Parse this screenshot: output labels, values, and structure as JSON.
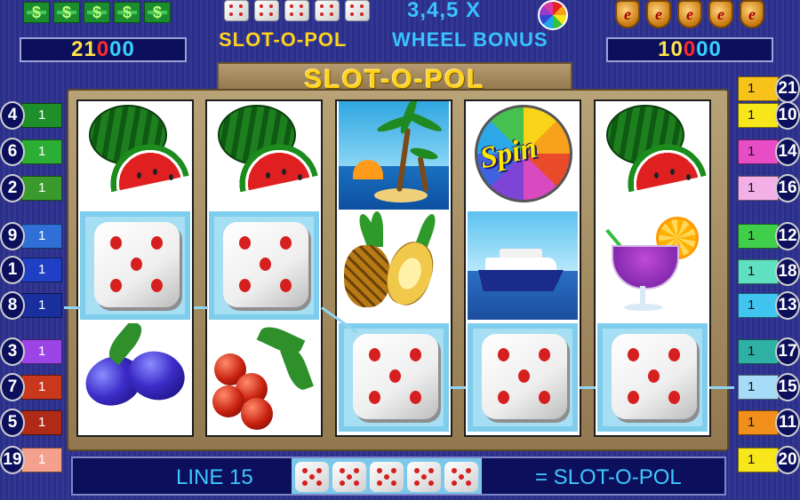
{
  "header": {
    "left_counter": {
      "k": "21",
      "z": "0",
      "r": "00"
    },
    "right_counter": {
      "k": "10",
      "z": "0",
      "r": "00"
    },
    "multiplier_text": "3,4,5 X",
    "title_left": "SLOT-O-POL",
    "title_right": "WHEEL BONUS",
    "money_icon_glyph": "$",
    "shield_glyph": "e"
  },
  "game_title": "SLOT-O-POL",
  "reels": [
    [
      "watermelon",
      "dice",
      "plum"
    ],
    [
      "watermelon",
      "dice",
      "cherry"
    ],
    [
      "palm-island",
      "pineapple",
      "dice"
    ],
    [
      "spin-wheel",
      "cruise-ship",
      "dice"
    ],
    [
      "watermelon",
      "cocktail",
      "dice"
    ]
  ],
  "spin_label": "Spin",
  "left_lines": [
    {
      "num": "4",
      "bet": "1",
      "color": "#1f8f2a"
    },
    {
      "num": "6",
      "bet": "1",
      "color": "#2cae35"
    },
    {
      "num": "2",
      "bet": "1",
      "color": "#3a9a2c"
    },
    {
      "num": "9",
      "bet": "1",
      "color": "#2f6fd6"
    },
    {
      "num": "1",
      "bet": "1",
      "color": "#1f3fc4"
    },
    {
      "num": "8",
      "bet": "1",
      "color": "#1a2f9e"
    },
    {
      "num": "3",
      "bet": "1",
      "color": "#9d44e6"
    },
    {
      "num": "7",
      "bet": "1",
      "color": "#c9381d"
    },
    {
      "num": "5",
      "bet": "1",
      "color": "#b02a18"
    },
    {
      "num": "19",
      "bet": "1",
      "color": "#f5a08c"
    }
  ],
  "right_lines": [
    {
      "num": "21",
      "bet": "1",
      "color": "#f7c21a"
    },
    {
      "num": "10",
      "bet": "1",
      "color": "#f7e61a"
    },
    {
      "num": "14",
      "bet": "1",
      "color": "#e84cc7"
    },
    {
      "num": "16",
      "bet": "1",
      "color": "#f2b0e6"
    },
    {
      "num": "12",
      "bet": "1",
      "color": "#3fcf4a"
    },
    {
      "num": "18",
      "bet": "1",
      "color": "#5fe0c0"
    },
    {
      "num": "13",
      "bet": "1",
      "color": "#40c4f0"
    },
    {
      "num": "17",
      "bet": "1",
      "color": "#2fb0a4"
    },
    {
      "num": "15",
      "bet": "1",
      "color": "#a6dcf7"
    },
    {
      "num": "11",
      "bet": "1",
      "color": "#f08f1a"
    },
    {
      "num": "20",
      "bet": "1",
      "color": "#f7e61a"
    }
  ],
  "status": {
    "line_label": "LINE 15",
    "win_label": "= SLOT-O-POL"
  }
}
